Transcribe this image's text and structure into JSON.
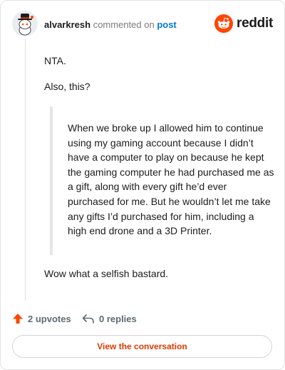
{
  "header": {
    "username": "alvarkresh",
    "verb": "commented on",
    "post_link": "post",
    "brand": "reddit",
    "avatar_icon": "snoo-avatar-icon",
    "brand_icon": "reddit-logo-icon",
    "brand_color": "#ff4500"
  },
  "comment": {
    "paragraph_1": "NTA.",
    "paragraph_2": "Also, this?",
    "quote": "When we broke up I allowed him to continue using my gaming account because I didn’t have a computer to play on because he kept the gaming computer he had purchased me as a gift, along with every gift he’d ever purchased for me. But he wouldn’t let me take any gifts I’d purchased for him, including a high end drone and a 3D Printer.",
    "paragraph_3": "Wow what a selfish bastard."
  },
  "actions": {
    "upvotes": "2 upvotes",
    "replies": "0 replies",
    "upvote_icon": "upvote-arrow-icon",
    "reply_icon": "reply-arrow-icon",
    "upvote_color": "#ff4500"
  },
  "cta": {
    "label": "View the conversation",
    "color": "#d93a00"
  }
}
